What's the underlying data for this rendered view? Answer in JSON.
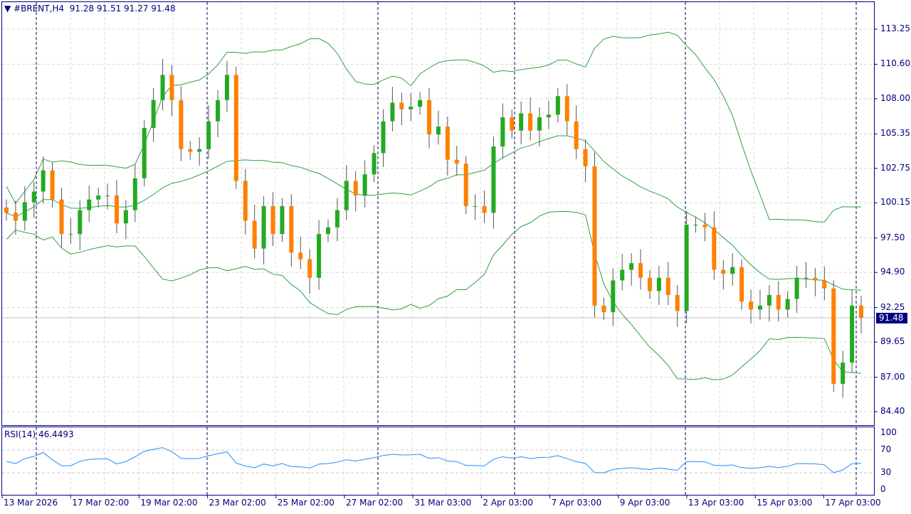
{
  "header": {
    "symbol": "#BRENT,H4",
    "ohlc": "91.28 91.51 91.27 91.48"
  },
  "current_price": "91.48",
  "rsi": {
    "label": "RSI(14)",
    "value": "46.4493",
    "levels": [
      "100",
      "70",
      "30",
      "0"
    ]
  },
  "price_axis": [
    "113.25",
    "110.60",
    "108.00",
    "105.35",
    "102.75",
    "100.15",
    "97.50",
    "94.90",
    "92.25",
    "89.65",
    "87.00",
    "84.40"
  ],
  "time_axis": [
    "13 Mar 2026",
    "17 Mar 02:00",
    "19 Mar 02:00",
    "23 Mar 02:00",
    "25 Mar 02:00",
    "27 Mar 02:00",
    "31 Mar 03:00",
    "2 Apr 03:00",
    "7 Apr 03:00",
    "9 Apr 03:00",
    "13 Apr 03:00",
    "15 Apr 03:00",
    "17 Apr 03:00"
  ],
  "colors": {
    "bull": "#22aa22",
    "bear": "#ff8000",
    "bands": "#2ea043",
    "rsi": "#1e90ff",
    "axis": "#00007a"
  },
  "chart_data": {
    "type": "candlestick",
    "ylim": [
      83.5,
      116.5
    ],
    "close": [
      99.4,
      98.8,
      100.2,
      101,
      102.6,
      100.4,
      97.8,
      97.8,
      99.6,
      100.4,
      100.7,
      100.7,
      98.6,
      99.6,
      102,
      105.8,
      107.9,
      109.8,
      107.9,
      104.2,
      104,
      104.2,
      106.3,
      107.9,
      109.8,
      101.8,
      98.8,
      96.7,
      99.9,
      97.8,
      99.9,
      96.4,
      95.9,
      94.5,
      97.8,
      98.3,
      99.6,
      101.8,
      100.7,
      102.3,
      103.9,
      106.3,
      107.7,
      107.2,
      107.4,
      107.9,
      105.3,
      105.9,
      103.4,
      103.1,
      99.9,
      99.9,
      99.4,
      104.4,
      106.6,
      105.6,
      106.9,
      105.6,
      106.6,
      106.8,
      108.2,
      106.3,
      104.2,
      102.9,
      92.4,
      91.9,
      94.3,
      95.1,
      95.6,
      94.5,
      93.5,
      94.5,
      93.2,
      92,
      98.5,
      98.5,
      98.3,
      95.1,
      94.8,
      95.3,
      92.7,
      92.1,
      92.4,
      93.2,
      92.1,
      92.9,
      94.5,
      94.5,
      94.3,
      93.7,
      86.5,
      88.1,
      92.4,
      91.48
    ]
  }
}
